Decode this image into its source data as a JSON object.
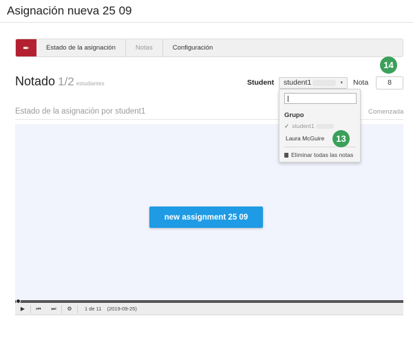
{
  "header": {
    "title": "Asignación nueva 25 09"
  },
  "toolbar": {
    "logo": "✒",
    "items": [
      "Estado de la asignación",
      "Notas",
      "Configuración"
    ]
  },
  "grading": {
    "title": "Notado",
    "fraction": "1/2",
    "students_word": "estudiantes",
    "student_label": "Student",
    "student_value": "student1",
    "caret": "▾",
    "nota_label": "Nota",
    "nota_value": "8"
  },
  "status": {
    "heading": "Estado de la asignación por student1",
    "state": "Comenzada"
  },
  "viewer": {
    "button_label": "new assignment 25 09",
    "controls": {
      "play": "▶",
      "prev": "⏮",
      "next": "⏭",
      "settings": "⚙",
      "frame": "1 de 11",
      "date": "(2019-09-25)"
    },
    "progress_fraction": 0.0
  },
  "dropdown": {
    "group_label": "Grupo",
    "check": "✓",
    "options": [
      "student1",
      "Laura McGuire"
    ],
    "clear_label": "Eliminar todas las notas"
  },
  "badges": [
    "14",
    "13"
  ],
  "colors": {
    "accent_red": "#b3202f",
    "badge_green": "#3aa05a",
    "button_blue": "#1e9be4",
    "viewer_bg": "#f1f3fd"
  }
}
